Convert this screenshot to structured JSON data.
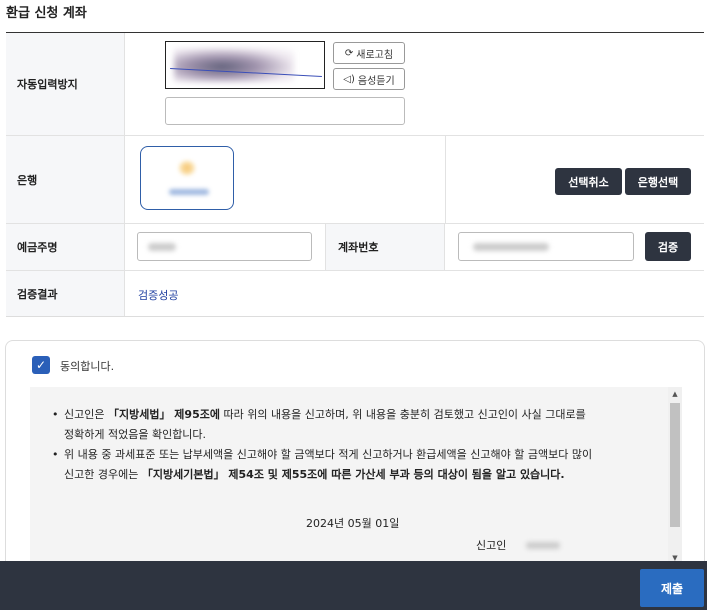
{
  "section": {
    "title": "환급 신청 계좌"
  },
  "captcha": {
    "label": "자동입력방지",
    "refresh_label": "새로고침",
    "audio_label": "음성듣기",
    "input_value": ""
  },
  "bank": {
    "label": "은행",
    "cancel_label": "선택취소",
    "select_label": "은행선택"
  },
  "holder": {
    "label": "예금주명"
  },
  "account": {
    "label": "계좌번호",
    "verify_label": "검증"
  },
  "result": {
    "label": "검증결과",
    "value": "검증성공"
  },
  "agreement": {
    "checked": true,
    "label": "동의합니다.",
    "p1_a": "신고인은 ",
    "p1_b": "「지방세법」 제95조에",
    "p1_c": " 따라 위의 내용을 신고하며, 위 내용을 충분히 검토했고 신고인이 사실 그대로를",
    "p1_d": "정확하게 적었음을 확인합니다.",
    "p2_a": "위 내용 중 과세표준 또는 납부세액을 신고해야 할 금액보다 적게 신고하거나 환급세액을 신고해야 할 금액보다 많이",
    "p2_b": "신고한 경우에는 ",
    "p2_c": "「지방세기본법」 제54조 및 제55조에 따른 가산세 부과 등의 대상이 됨을 알고 있습니다.",
    "date": "2024년 05월 01일",
    "reporter_label": "신고인"
  },
  "footer": {
    "submit_label": "제출"
  },
  "colors": {
    "accent": "#2a6cc0",
    "dark_button": "#2e3440",
    "success_text": "#1f3fa0"
  },
  "icons": [
    "refresh-icon",
    "speaker-icon",
    "check-icon",
    "scroll-up-icon",
    "scroll-down-icon"
  ]
}
